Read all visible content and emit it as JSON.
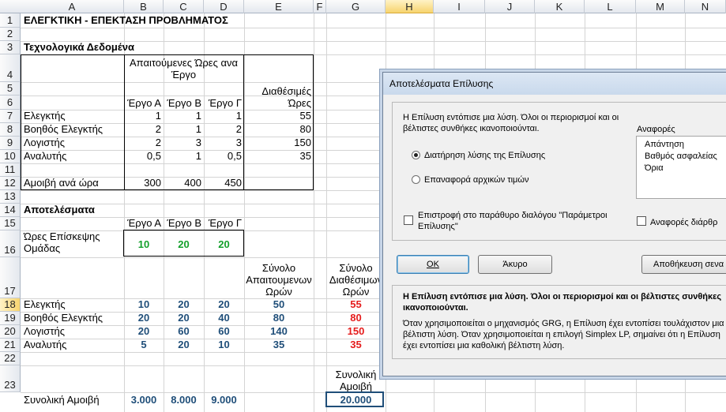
{
  "columns": [
    "A",
    "B",
    "C",
    "D",
    "E",
    "F",
    "G",
    "H",
    "I",
    "J",
    "K",
    "L",
    "M",
    "N"
  ],
  "rows": [
    "1",
    "2",
    "3",
    "4",
    "5",
    "6",
    "7",
    "8",
    "9",
    "10",
    "11",
    "12",
    "13",
    "14",
    "15",
    "16",
    "17",
    "18",
    "19",
    "20",
    "21",
    "22",
    "23"
  ],
  "cells": {
    "title": "ΕΛΕΓΚΤΙΚΗ - ΕΠΕΚΤΑΣΗ ΠΡΟΒΛΗΜΑΤΟΣ",
    "tech_header": "Τεχνολογικά Δεδομένα",
    "required_hours": "Απαιτούμενες Ώρες ανα Έργο",
    "available_hours": "Διαθέσιμές Ώρες",
    "project_a": "Έργο Α",
    "project_b": "Έργο Β",
    "project_c": "Έργο Γ",
    "roles": [
      "Ελεγκτής",
      "Βοηθός Ελεγκτής",
      "Λογιστής",
      "Αναλυτής"
    ],
    "tech": [
      [
        "1",
        "1",
        "1",
        "55"
      ],
      [
        "2",
        "1",
        "2",
        "80"
      ],
      [
        "2",
        "3",
        "3",
        "150"
      ],
      [
        "0,5",
        "1",
        "0,5",
        "35"
      ]
    ],
    "fee_label": "Αμοιβή ανά ώρα",
    "fees": [
      "300",
      "400",
      "450"
    ],
    "results_header": "Αποτελέσματα",
    "visit_hours_label": "Ώρες Επίσκεψης Ομάδας",
    "visit_hours": [
      "10",
      "20",
      "20"
    ],
    "total_required": "Σύνολο Απαιτουμενων Ωρών",
    "total_available": "Σύνολο Διαθέσιμων Ωρών",
    "results": [
      [
        "10",
        "20",
        "20",
        "50",
        "55"
      ],
      [
        "20",
        "20",
        "40",
        "80",
        "80"
      ],
      [
        "20",
        "60",
        "60",
        "140",
        "150"
      ],
      [
        "5",
        "20",
        "10",
        "35",
        "35"
      ]
    ],
    "total_fee_header": "Συνολική Αμοιβή",
    "total_fee_label": "Συνολική Αμοιβή",
    "total_fees": [
      "3.000",
      "8.000",
      "9.000"
    ],
    "grand_total": "20.000"
  },
  "dialog": {
    "title": "Αποτελέσματα Επίλυσης",
    "message": "Η Επίλυση εντόπισε μια λύση. Όλοι οι περιορισμοί και οι βέλτιστες συνθήκες ικανοποιούνται.",
    "reports_label": "Αναφορές",
    "reports": [
      "Απάντηση",
      "Βαθμός ασφαλείας",
      "Όρια"
    ],
    "keep_solution": "Διατήρηση λύσης της Επίλυσης",
    "restore_values": "Επαναφορά αρχικών τιμών",
    "return_to_dialog": "Επιστροφή στο παράθυρο διαλόγου \"Παράμετροι Επίλυσης\"",
    "outline_reports": "Αναφορές διάρθρ",
    "ok": "OK",
    "cancel": "Άκυρο",
    "save_scenario": "Αποθήκευση σενα",
    "bold_message": "Η Επίλυση εντόπισε μια λύση. Όλοι οι περιορισμοί και οι βέλτιστες συνθήκες ικανοποιούνται.",
    "detail": "Όταν χρησιμοποιείται ο μηχανισμός GRG, η Επίλυση έχει εντοπίσει τουλάχιστον μια βέλτιστη λύση. Όταν χρησιμοποιείται η επιλογή Simplex LP, σημαίνει ότι η Επίλυση έχει εντοπίσει μια καθολική βέλτιστη λύση."
  }
}
